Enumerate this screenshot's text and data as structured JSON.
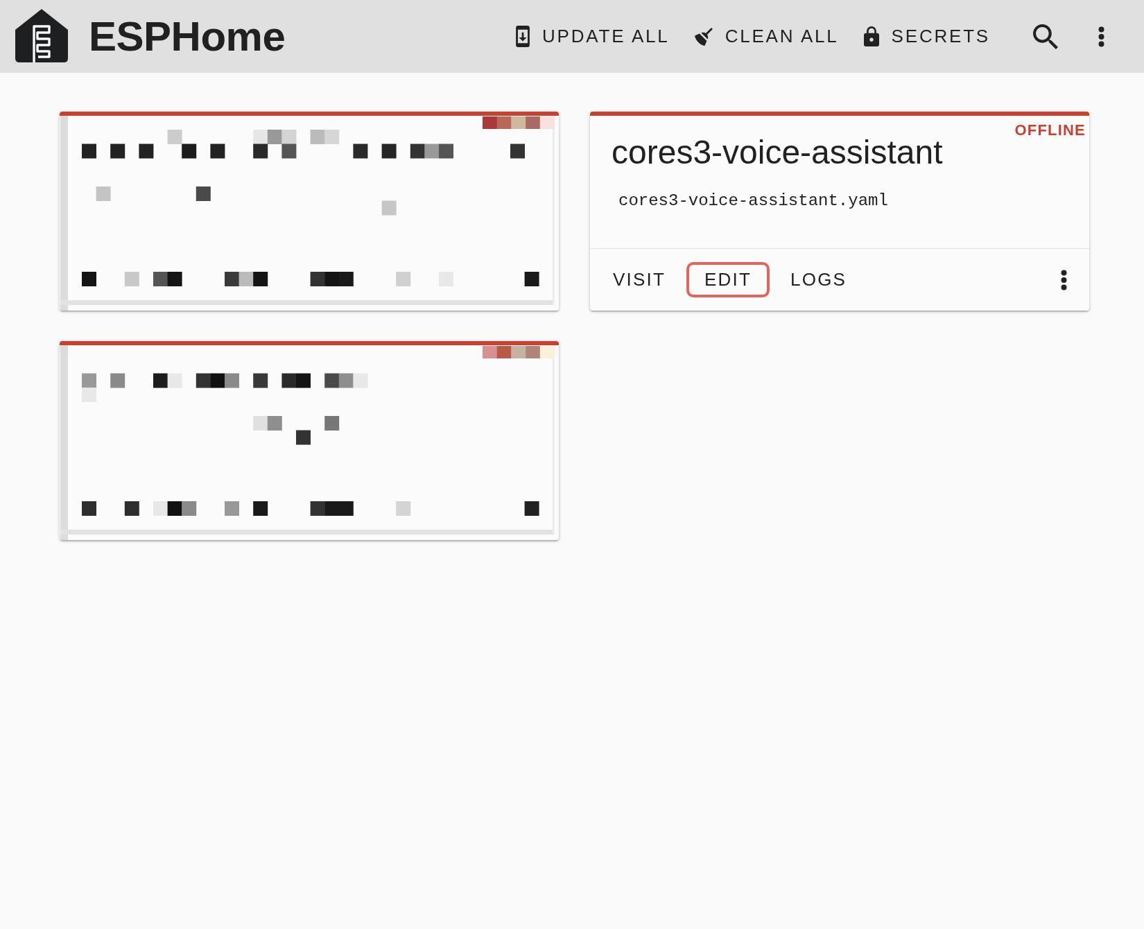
{
  "header": {
    "app_name": "ESPHome",
    "actions": [
      {
        "kind": "update",
        "label": "UPDATE ALL"
      },
      {
        "kind": "clean",
        "label": "CLEAN ALL"
      },
      {
        "kind": "secrets",
        "label": "SECRETS"
      }
    ]
  },
  "devices": [
    {
      "kind": "pixelated",
      "online": false
    },
    {
      "kind": "device",
      "online": false,
      "name": "cores3-voice-assistant",
      "file": "cores3-voice-assistant.yaml",
      "status": "OFFLINE",
      "actions": [
        {
          "label": "VISIT",
          "highlighted": false
        },
        {
          "label": "EDIT",
          "highlighted": true
        },
        {
          "label": "LOGS",
          "highlighted": false
        }
      ]
    },
    {
      "kind": "pixelated",
      "online": false
    }
  ]
}
